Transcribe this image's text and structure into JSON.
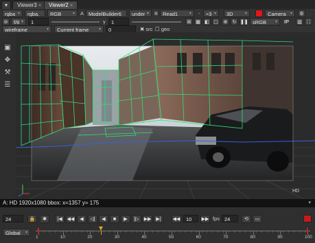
{
  "tabs": [
    {
      "label": "Viewer3",
      "close": "×"
    },
    {
      "label": "Viewer2",
      "close": "×"
    }
  ],
  "toolbar1": {
    "channels": "rgba",
    "alpha": "rgba.",
    "color": "RGB",
    "a_prefix": "A",
    "a_input": "ModelBuilder6",
    "mode": "under",
    "b_prefix": "B",
    "b_input": "Read1",
    "dash": "-",
    "step": "÷3",
    "view": "3D",
    "camera": "Camera",
    "red_color": "#e01818"
  },
  "toolbar2": {
    "fstop": "f/8",
    "gain": "1",
    "gamma_label": "γ",
    "gamma": "1",
    "colorspace": "sRGB",
    "ip": "IP"
  },
  "toolbar3": {
    "display": "wireframe",
    "frame_mode": "Current frame",
    "frame_value": "0",
    "src_label": "src",
    "geo_label": "geo"
  },
  "viewer": {
    "format_label": "HD"
  },
  "info": {
    "text": "A: HD 1920x1080 bbox: x=1357 y= 175"
  },
  "playback": {
    "frame": "24",
    "step": "10",
    "fps_label": "fps",
    "fps": "24",
    "range_mode": "Global",
    "start": "1",
    "end": "100",
    "ticks": [
      "1",
      "10",
      "20",
      "30",
      "40",
      "50",
      "60",
      "70",
      "80",
      "90",
      "100"
    ],
    "current_marker": "24"
  }
}
